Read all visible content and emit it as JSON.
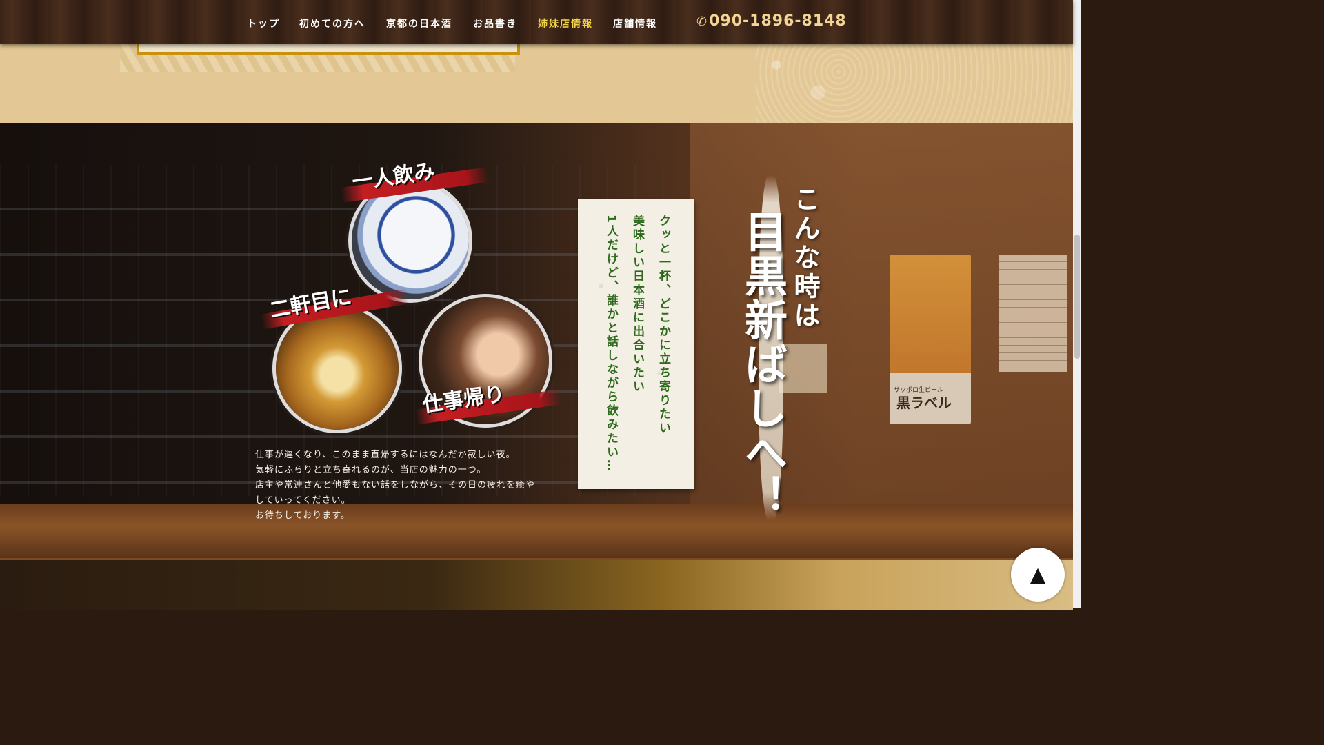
{
  "nav": {
    "items": [
      {
        "label": "トップ",
        "active": false
      },
      {
        "label": "初めての方へ",
        "active": false
      },
      {
        "label": "京都の日本酒",
        "active": false
      },
      {
        "label": "お品書き",
        "active": false
      },
      {
        "label": "姉妹店情報",
        "active": true
      },
      {
        "label": "店舗情報",
        "active": false
      }
    ],
    "phone": "090-1896-8148",
    "phone_icon": "phone-icon",
    "active_color": "#f0d348"
  },
  "labels": {
    "hitori_nomi": "一人飲み",
    "nikenme": "二軒目に",
    "shigoto_gaeri": "仕事帰り"
  },
  "body": {
    "line1": "仕事が遅くなり、このまま直帰するにはなんだか寂しい夜。",
    "line2": "気軽にふらりと立ち寄れるのが、当店の魅力の一つ。",
    "line3": "店主や常連さんと他愛もない話をしながら、その日の疲れを癒やしていってください。",
    "line4": "お待ちしております。"
  },
  "card": {
    "line1": "クッと一杯、どこかに立ち寄りたい",
    "line2": "美味しい日本酒に出合いたい",
    "line3": "1人だけど、誰かと話しながら飲みたい…"
  },
  "headline": {
    "small": "こんな時は",
    "big": "目黒新ばしへ！"
  },
  "poster": {
    "brand": "サッポロ生ビール",
    "name": "黒ラベル"
  },
  "to_top": "▲",
  "colors": {
    "card_text": "#2e6a1c",
    "brush_red": "#c41e22",
    "phone": "#f3d596"
  }
}
